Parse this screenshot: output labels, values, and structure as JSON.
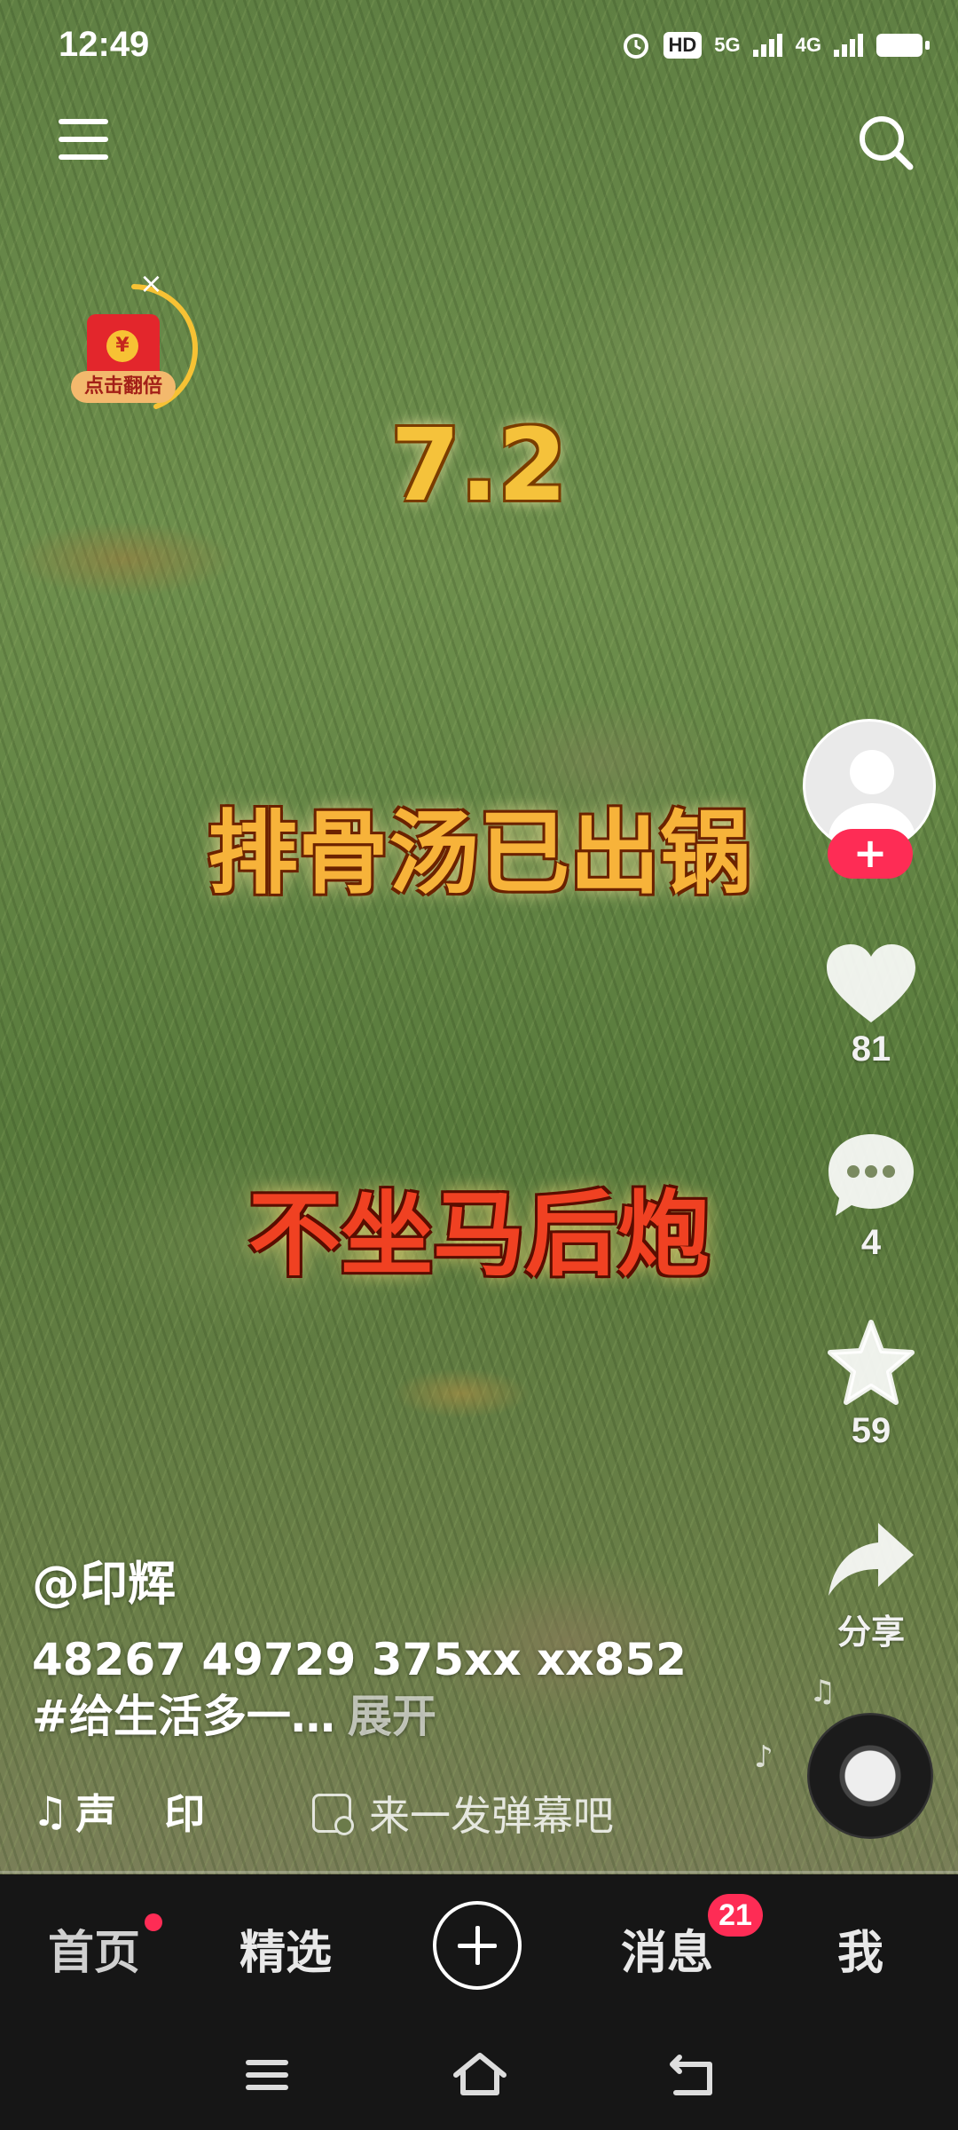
{
  "status_bar": {
    "time": "12:49",
    "hd_label": "HD",
    "net1": "5G",
    "net2": "4G",
    "icons": [
      "alarm-icon",
      "hd-icon",
      "signal-5g-icon",
      "signal-4g-icon",
      "battery-icon"
    ]
  },
  "top_bar": {
    "menu_icon": "menu-icon",
    "search_icon": "search-icon"
  },
  "red_packet": {
    "coin_symbol": "¥",
    "label": "点击翻倍",
    "close_symbol": "×"
  },
  "video_captions": {
    "date": "7.2",
    "line1": "排骨汤已出锅",
    "line2": "不坐马后炮"
  },
  "side_actions": {
    "follow_symbol": "+",
    "like_count": "81",
    "comment_count": "4",
    "favorite_count": "59",
    "share_label": "分享"
  },
  "post": {
    "author": "@印辉",
    "description": "48267 49729 375xx xx852 #给生活多一…",
    "expand_label": "展开",
    "music_note": "♫",
    "music_text_1": "声",
    "music_text_2": "印",
    "danmu_placeholder": "来一发弹幕吧"
  },
  "tab_bar": {
    "home": "首页",
    "featured": "精选",
    "messages": "消息",
    "messages_badge": "21",
    "me": "我"
  },
  "colors": {
    "accent_red": "#fe2c55",
    "tab_bar_bg": "#161616",
    "caption_gold": "#f5c23b",
    "caption_red": "#f04122"
  }
}
